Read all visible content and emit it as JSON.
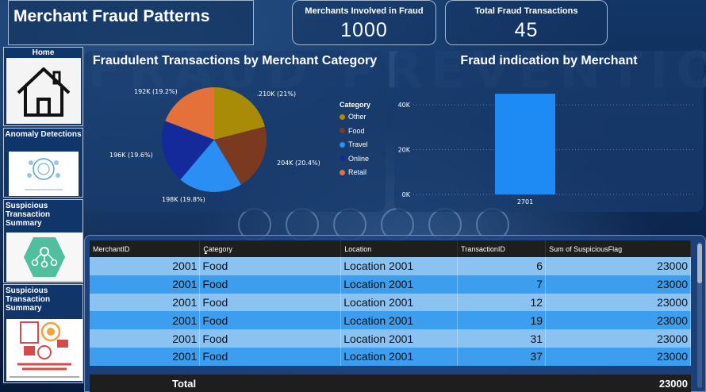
{
  "title": "Merchant Fraud Patterns",
  "kpis": [
    {
      "label": "Merchants Involved in Fraud",
      "value": "1000"
    },
    {
      "label": "Total Fraud Transactions",
      "value": "45"
    }
  ],
  "nav": [
    {
      "label": "Home",
      "icon": "house-icon"
    },
    {
      "label": "Anomaly Detections",
      "icon": "anomaly-detection-icon"
    },
    {
      "label": "Suspicious Transaction Summary",
      "icon": "network-icon"
    },
    {
      "label": "Suspicious Transaction Summary",
      "icon": "fraud-detection-icon"
    }
  ],
  "background_text": "FRAUD PREVENTION",
  "pie": {
    "title": "Fraudulent Transactions by Merchant Category",
    "legend_title": "Category",
    "labels": {
      "other": "210K (21%)",
      "food": "204K (20.4%)",
      "travel": "198K (19.8%)",
      "online": "196K (19.6%)",
      "retail": "192K (19.2%)"
    }
  },
  "bar": {
    "title": "Fraud indication by Merchant",
    "y_ticks": [
      "40K",
      "20K",
      "0K"
    ],
    "category": "2701"
  },
  "chart_data": [
    {
      "type": "pie",
      "title": "Fraudulent Transactions by Merchant Category",
      "legend_title": "Category",
      "categories": [
        "Other",
        "Food",
        "Travel",
        "Online",
        "Retail"
      ],
      "values": [
        210000,
        204000,
        198000,
        196000,
        192000
      ],
      "percents": [
        21,
        20.4,
        19.8,
        19.6,
        19.2
      ],
      "colors": [
        "#a98b08",
        "#7b3a20",
        "#2b8ef5",
        "#14299a",
        "#e4703a"
      ],
      "legend": "right"
    },
    {
      "type": "bar",
      "title": "Fraud indication by Merchant",
      "categories": [
        "2701"
      ],
      "values": [
        45000
      ],
      "ylim": [
        0,
        50000
      ],
      "y_ticks": [
        0,
        20000,
        40000
      ],
      "grid": true,
      "color": "#1e8bf5"
    }
  ],
  "table": {
    "columns": [
      "MerchantID",
      "Category",
      "Location",
      "TransactionID",
      "Sum of SuspiciousFlag"
    ],
    "rows": [
      [
        "2001",
        "Food",
        "Location 2001",
        "6",
        "23000"
      ],
      [
        "2001",
        "Food",
        "Location 2001",
        "7",
        "23000"
      ],
      [
        "2001",
        "Food",
        "Location 2001",
        "12",
        "23000"
      ],
      [
        "2001",
        "Food",
        "Location 2001",
        "19",
        "23000"
      ],
      [
        "2001",
        "Food",
        "Location 2001",
        "31",
        "23000"
      ],
      [
        "2001",
        "Food",
        "Location 2001",
        "37",
        "23000"
      ]
    ],
    "total_label": "Total",
    "total_value": "23000"
  }
}
